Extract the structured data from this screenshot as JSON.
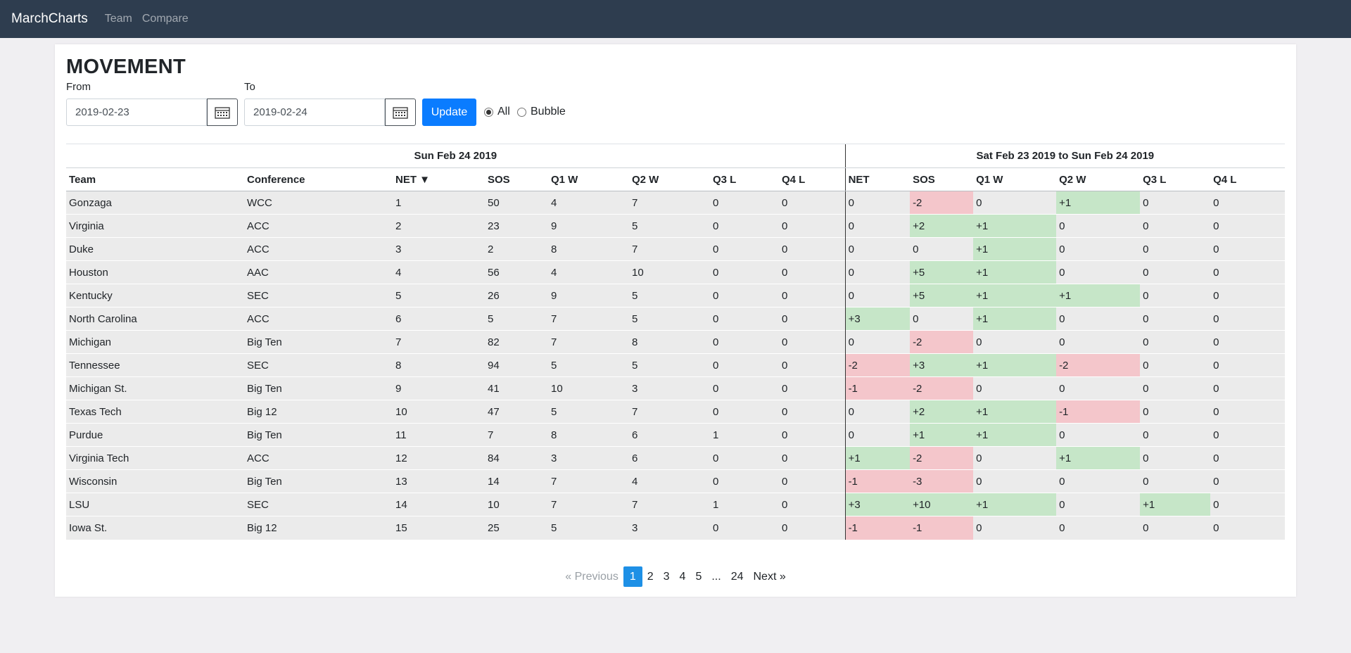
{
  "nav": {
    "brand": "MarchCharts",
    "links": [
      "Team",
      "Compare"
    ]
  },
  "page": {
    "title": "MOVEMENT",
    "from_label": "From",
    "to_label": "To",
    "from_value": "2019-02-23",
    "to_value": "2019-02-24",
    "update_label": "Update",
    "radio_all": "All",
    "radio_bubble": "Bubble",
    "selected_filter": "All"
  },
  "table": {
    "group_current": "Sun Feb 24 2019",
    "group_change": "Sat Feb 23 2019 to Sun Feb 24 2019",
    "columns": [
      "Team",
      "Conference",
      "NET ▼",
      "SOS",
      "Q1 W",
      "Q2 W",
      "Q3 L",
      "Q4 L",
      "NET",
      "SOS",
      "Q1 W",
      "Q2 W",
      "Q3 L",
      "Q4 L"
    ],
    "rows": [
      [
        "Gonzaga",
        "WCC",
        "1",
        "50",
        "4",
        "7",
        "0",
        "0",
        "0",
        "-2",
        "0",
        "+1",
        "0",
        "0"
      ],
      [
        "Virginia",
        "ACC",
        "2",
        "23",
        "9",
        "5",
        "0",
        "0",
        "0",
        "+2",
        "+1",
        "0",
        "0",
        "0"
      ],
      [
        "Duke",
        "ACC",
        "3",
        "2",
        "8",
        "7",
        "0",
        "0",
        "0",
        "0",
        "+1",
        "0",
        "0",
        "0"
      ],
      [
        "Houston",
        "AAC",
        "4",
        "56",
        "4",
        "10",
        "0",
        "0",
        "0",
        "+5",
        "+1",
        "0",
        "0",
        "0"
      ],
      [
        "Kentucky",
        "SEC",
        "5",
        "26",
        "9",
        "5",
        "0",
        "0",
        "0",
        "+5",
        "+1",
        "+1",
        "0",
        "0"
      ],
      [
        "North Carolina",
        "ACC",
        "6",
        "5",
        "7",
        "5",
        "0",
        "0",
        "+3",
        "0",
        "+1",
        "0",
        "0",
        "0"
      ],
      [
        "Michigan",
        "Big Ten",
        "7",
        "82",
        "7",
        "8",
        "0",
        "0",
        "0",
        "-2",
        "0",
        "0",
        "0",
        "0"
      ],
      [
        "Tennessee",
        "SEC",
        "8",
        "94",
        "5",
        "5",
        "0",
        "0",
        "-2",
        "+3",
        "+1",
        "-2",
        "0",
        "0"
      ],
      [
        "Michigan St.",
        "Big Ten",
        "9",
        "41",
        "10",
        "3",
        "0",
        "0",
        "-1",
        "-2",
        "0",
        "0",
        "0",
        "0"
      ],
      [
        "Texas Tech",
        "Big 12",
        "10",
        "47",
        "5",
        "7",
        "0",
        "0",
        "0",
        "+2",
        "+1",
        "-1",
        "0",
        "0"
      ],
      [
        "Purdue",
        "Big Ten",
        "11",
        "7",
        "8",
        "6",
        "1",
        "0",
        "0",
        "+1",
        "+1",
        "0",
        "0",
        "0"
      ],
      [
        "Virginia Tech",
        "ACC",
        "12",
        "84",
        "3",
        "6",
        "0",
        "0",
        "+1",
        "-2",
        "0",
        "+1",
        "0",
        "0"
      ],
      [
        "Wisconsin",
        "Big Ten",
        "13",
        "14",
        "7",
        "4",
        "0",
        "0",
        "-1",
        "-3",
        "0",
        "0",
        "0",
        "0"
      ],
      [
        "LSU",
        "SEC",
        "14",
        "10",
        "7",
        "7",
        "1",
        "0",
        "+3",
        "+10",
        "+1",
        "0",
        "+1",
        "0"
      ],
      [
        "Iowa St.",
        "Big 12",
        "15",
        "25",
        "5",
        "3",
        "0",
        "0",
        "-1",
        "-1",
        "0",
        "0",
        "0",
        "0"
      ]
    ]
  },
  "pagination": {
    "prev": "«  Previous",
    "pages": [
      "1",
      "2",
      "3",
      "4",
      "5",
      "...",
      "24"
    ],
    "current": "1",
    "next": "Next  »"
  },
  "colors": {
    "navbar": "#2e3d4f",
    "primary": "#0a7cff",
    "positive": "#c6e6c8",
    "negative": "#f4c6cb",
    "page_active": "#1e90e6"
  }
}
